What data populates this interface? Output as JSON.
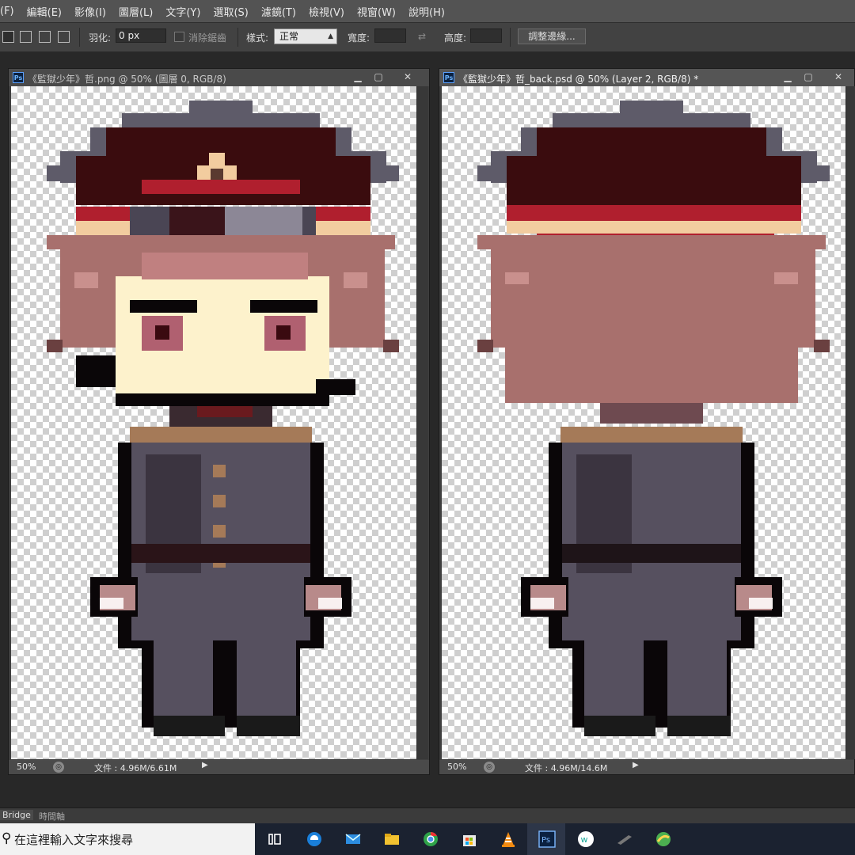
{
  "menu": [
    "(F)",
    "編輯(E)",
    "影像(I)",
    "圖層(L)",
    "文字(Y)",
    "選取(S)",
    "濾鏡(T)",
    "檢視(V)",
    "視窗(W)",
    "說明(H)"
  ],
  "options": {
    "feather_label": "羽化:",
    "feather_value": "0 px",
    "antialias_label": "消除鋸齒",
    "style_label": "樣式:",
    "style_value": "正常",
    "width_label": "寬度:",
    "height_label": "高度:",
    "refine_edge_label": "調整邊緣..."
  },
  "documents": [
    {
      "title": "《監獄少年》哲.png @ 50% (圖層 0, RGB/8)",
      "zoom": "50%",
      "doc_size": "文件 : 4.96M/6.61M",
      "active": false
    },
    {
      "title": "《監獄少年》哲_back.psd @ 50% (Layer 2, RGB/8) *",
      "zoom": "50%",
      "doc_size": "文件 : 4.96M/14.6M",
      "active": true
    }
  ],
  "panel_tabs": [
    "Bridge",
    "時間軸"
  ],
  "taskbar": {
    "search_placeholder": "在這裡輸入文字來搜尋",
    "apps": [
      "task-view-icon",
      "edge-icon",
      "mail-icon",
      "file-explorer-icon",
      "chrome-icon",
      "store-icon",
      "vlc-icon",
      "photoshop-icon",
      "w-app-icon",
      "pen-app-icon",
      "map-app-icon"
    ]
  },
  "colors": {
    "hat_band": "#5e5b69",
    "hat": "#3a0c0e",
    "hat_trim_red": "#b01f2e",
    "hat_trim_tan": "#f2cc9f",
    "hair": "#a8706d",
    "hair_light": "#c9908d",
    "skin": "#fdf2cc",
    "outline": "#0a0608",
    "uniform": "#56505f",
    "uniform_dark": "#3b3440",
    "button": "#a57a58"
  }
}
